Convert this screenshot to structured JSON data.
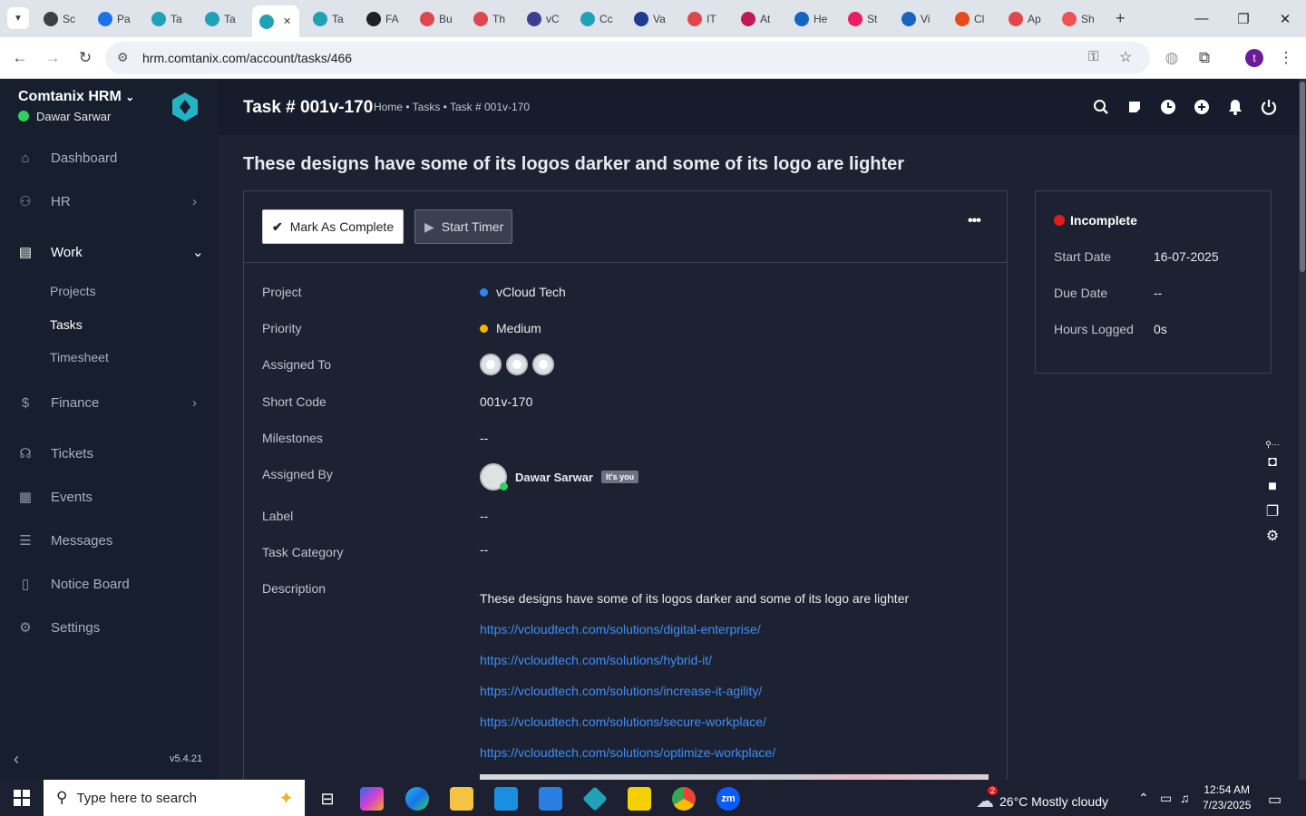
{
  "browser": {
    "tabs": [
      {
        "label": "Sc",
        "color": "#3c4043"
      },
      {
        "label": "Pa",
        "color": "#1a73e8"
      },
      {
        "label": "Ta",
        "color": "#1fa2b5"
      },
      {
        "label": "Ta",
        "color": "#1fa2b5"
      },
      {
        "label": "",
        "color": "#1fa2b5"
      },
      {
        "label": "Ta",
        "color": "#1fa2b5"
      },
      {
        "label": "FA",
        "color": "#202124"
      },
      {
        "label": "Bu",
        "color": "#e0474c"
      },
      {
        "label": "Th",
        "color": "#e0474c"
      },
      {
        "label": "vC",
        "color": "#3b3f8f"
      },
      {
        "label": "Cc",
        "color": "#1fa2b5"
      },
      {
        "label": "Va",
        "color": "#1b3c8f"
      },
      {
        "label": "IT",
        "color": "#e0474c"
      },
      {
        "label": "At",
        "color": "#c2185b"
      },
      {
        "label": "He",
        "color": "#1565c0"
      },
      {
        "label": "St",
        "color": "#e91e63"
      },
      {
        "label": "Vi",
        "color": "#1565c0"
      },
      {
        "label": "Cl",
        "color": "#e64a19"
      },
      {
        "label": "Ap",
        "color": "#e0474c"
      },
      {
        "label": "Sh",
        "color": "#ef5350"
      }
    ],
    "url": "hrm.comtanix.com/account/tasks/466",
    "profile_initial": "t"
  },
  "sidebar": {
    "brand": "Comtanix HRM",
    "user": "Dawar Sarwar",
    "items": [
      {
        "label": "Dashboard",
        "icon": "home-icon"
      },
      {
        "label": "HR",
        "icon": "users-icon"
      },
      {
        "label": "Work",
        "icon": "briefcase-icon"
      },
      {
        "label": "Finance",
        "icon": "dollar-icon"
      },
      {
        "label": "Tickets",
        "icon": "headset-icon"
      },
      {
        "label": "Events",
        "icon": "calendar-icon"
      },
      {
        "label": "Messages",
        "icon": "message-icon"
      },
      {
        "label": "Notice Board",
        "icon": "clipboard-icon"
      },
      {
        "label": "Settings",
        "icon": "gear-icon"
      }
    ],
    "work_sub": [
      "Projects",
      "Tasks",
      "Timesheet"
    ],
    "version": "v5.4.21"
  },
  "header": {
    "title": "Task # 001v-170",
    "breadcrumb": "Home • Tasks • Task # 001v-170"
  },
  "task": {
    "heading": "These designs have some of its logos darker and some of its logo are lighter",
    "mark_complete": "Mark As Complete",
    "start_timer": "Start Timer",
    "more": "•••",
    "fields": {
      "project_label": "Project",
      "project_value": "vCloud Tech",
      "priority_label": "Priority",
      "priority_value": "Medium",
      "assigned_to_label": "Assigned To",
      "short_code_label": "Short Code",
      "short_code_value": "001v-170",
      "milestones_label": "Milestones",
      "milestones_value": "--",
      "assigned_by_label": "Assigned By",
      "assigned_by_value": "Dawar Sarwar",
      "its_you": "It's you",
      "label_label": "Label",
      "label_value": "--",
      "category_label": "Task Category",
      "category_value": "--",
      "description_label": "Description"
    },
    "description": "These designs have some of its logos darker and some of its logo are lighter",
    "links": [
      "https://vcloudtech.com/solutions/digital-enterprise/",
      "https://vcloudtech.com/solutions/hybrid-it/",
      "https://vcloudtech.com/solutions/increase-it-agility/",
      "https://vcloudtech.com/solutions/secure-workplace/",
      "https://vcloudtech.com/solutions/optimize-workplace/"
    ]
  },
  "summary": {
    "status": "Incomplete",
    "start_label": "Start Date",
    "start_value": "16-07-2025",
    "due_label": "Due Date",
    "due_value": "--",
    "hours_label": "Hours Logged",
    "hours_value": "0s"
  },
  "taskbar": {
    "search_placeholder": "Type here to search",
    "weather_badge": "2",
    "weather": "26°C  Mostly cloudy",
    "time": "12:54 AM",
    "date": "7/23/2025"
  },
  "colors": {
    "project_dot": "#2f86f0",
    "priority_dot": "#f5b400",
    "incomplete": "#e21c1c",
    "link": "#3e8ef7"
  }
}
